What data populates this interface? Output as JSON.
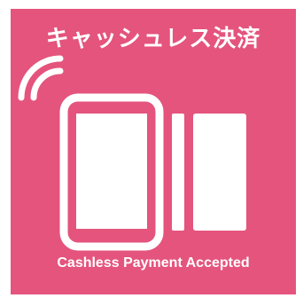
{
  "sign": {
    "title_jp": "キャッシュレス決済",
    "caption_en": "Cashless Payment Accepted"
  },
  "icons": {
    "phone": "smartphone-icon",
    "wireless": "wireless-signal-icon",
    "card": "payment-card-icon"
  },
  "colors": {
    "background": "#e4547d",
    "foreground": "#ffffff"
  }
}
